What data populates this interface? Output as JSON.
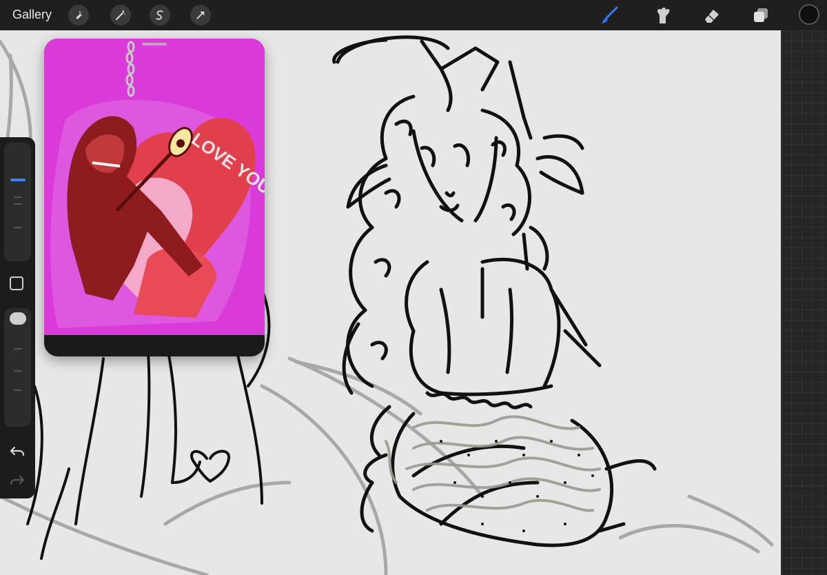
{
  "toolbar": {
    "gallery_label": "Gallery",
    "left_tools": [
      {
        "name": "actions-wrench-icon"
      },
      {
        "name": "adjustments-magic-wand-icon"
      },
      {
        "name": "selection-s-icon"
      },
      {
        "name": "transform-arrow-icon"
      }
    ],
    "right_tools": [
      {
        "name": "brush-icon",
        "active": true
      },
      {
        "name": "smudge-icon"
      },
      {
        "name": "eraser-icon"
      },
      {
        "name": "layers-icon"
      }
    ],
    "current_color": "#0f0f0f",
    "accent": "#2f7df6"
  },
  "sidebar": {
    "brush_size_level": 0.2,
    "opacity_level": 0.0
  },
  "reference": {
    "keychain_text": "LOVE YOUR SELF"
  }
}
